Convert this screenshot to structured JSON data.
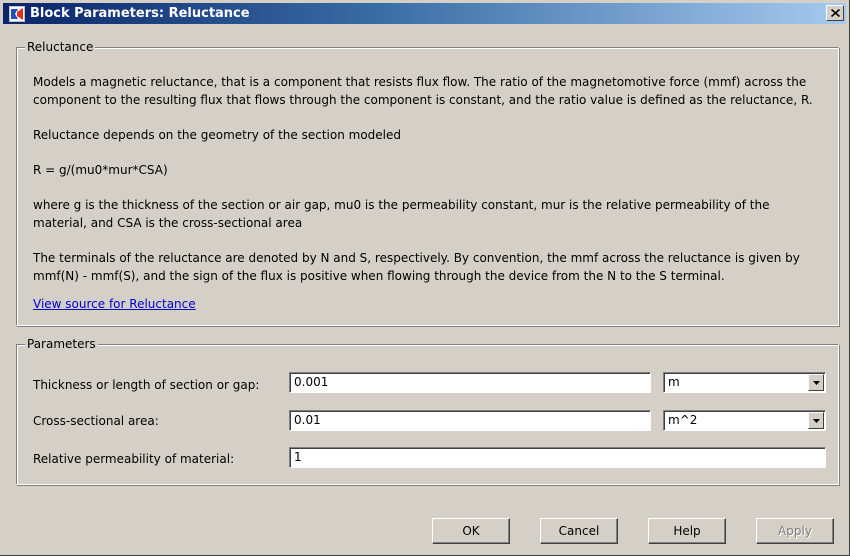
{
  "window": {
    "title": "Block Parameters: Reluctance",
    "icon": "simulink-block-icon",
    "close_icon": "close-icon"
  },
  "description_group": {
    "legend": "Reluctance",
    "paragraphs": [
      "Models a magnetic reluctance, that is a component that resists flux flow. The ratio of the magnetomotive force (mmf) across the",
      "component to the resulting flux that flows through the component is constant, and the ratio value is defined as the reluctance, R.",
      "Reluctance depends on the geometry of the section modeled",
      "R = g/(mu0*mur*CSA)",
      "where g is the thickness of the section or air gap, mu0 is the permeability constant, mur is the relative permeability of the",
      "material, and CSA is the cross-sectional area",
      "The terminals of the reluctance are denoted by N and S, respectively. By convention, the mmf across the reluctance is given by",
      "mmf(N) - mmf(S), and the sign of the flux is positive when flowing through the device from the N to the S terminal."
    ],
    "link": "View source for Reluctance"
  },
  "parameters_group": {
    "legend": "Parameters",
    "rows": [
      {
        "label": "Thickness or length of section or gap:",
        "value": "0.001",
        "unit": "m"
      },
      {
        "label": "Cross-sectional area:",
        "value": "0.01",
        "unit": "m^2"
      },
      {
        "label": "Relative permeability of material:",
        "value": "1"
      }
    ]
  },
  "buttons": {
    "ok": "OK",
    "cancel": "Cancel",
    "help": "Help",
    "apply": "Apply"
  }
}
